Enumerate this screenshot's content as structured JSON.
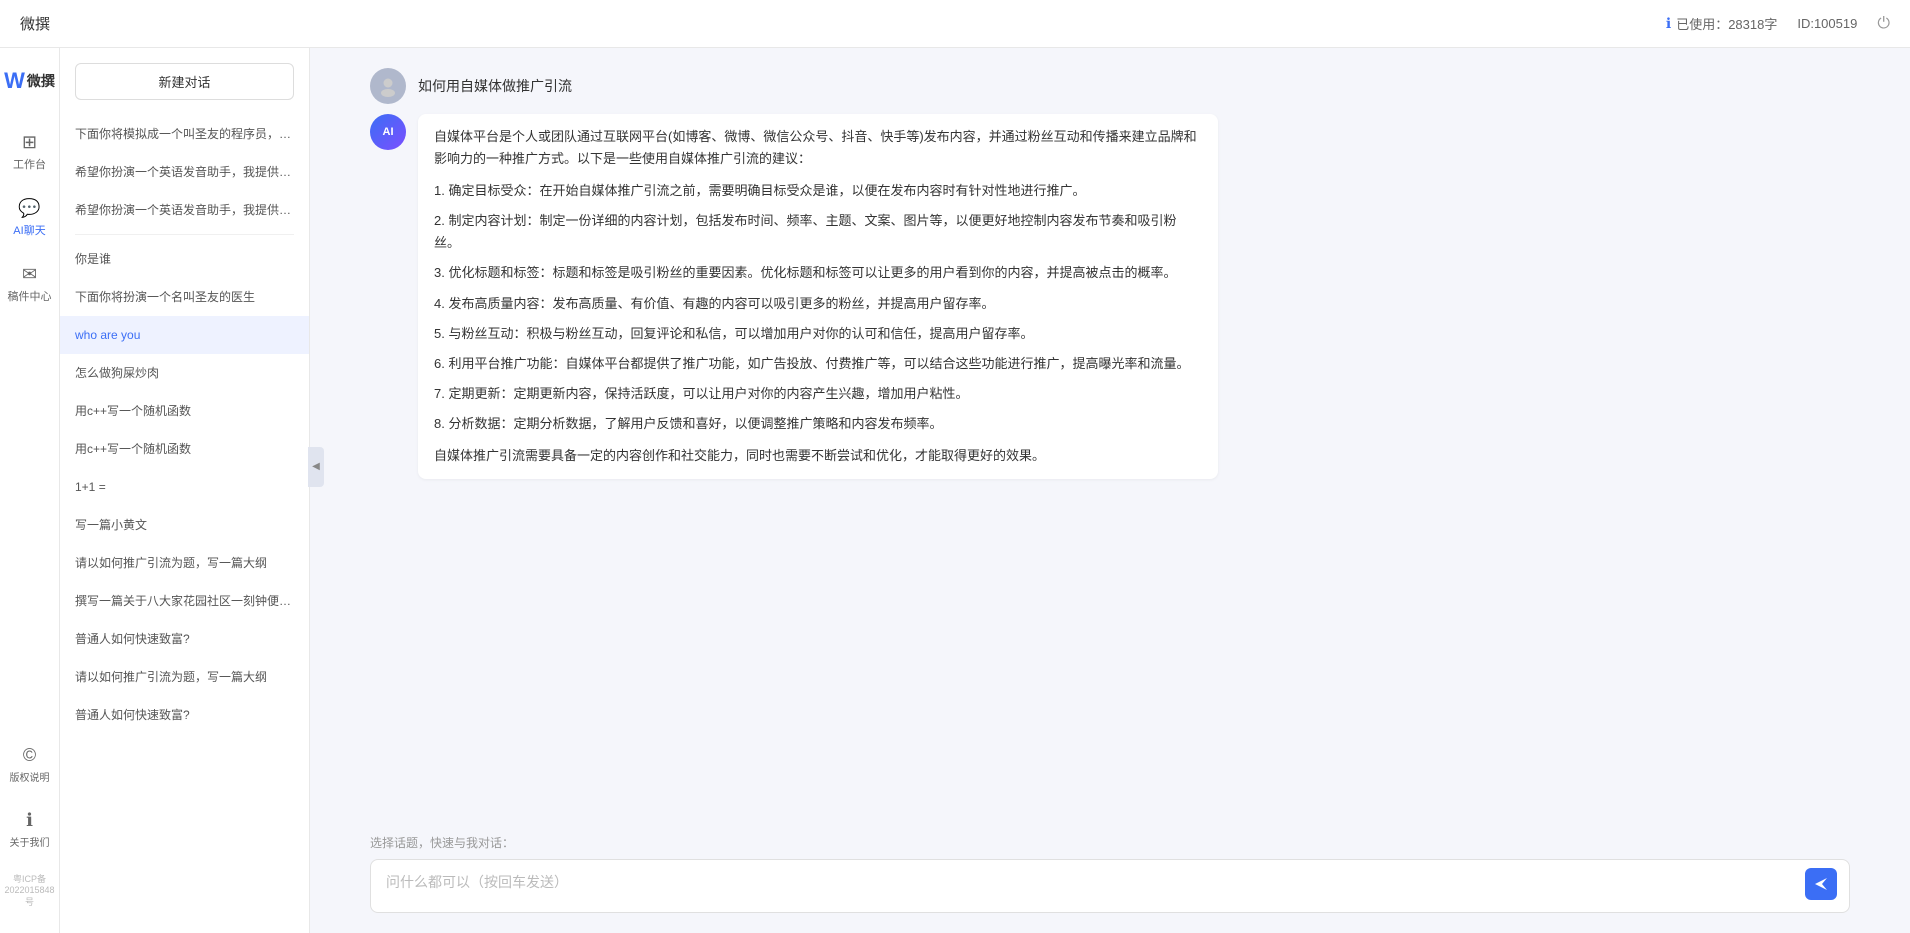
{
  "topbar": {
    "title": "微撰",
    "usage_label": "已使用：28318字",
    "id_label": "ID:100519",
    "usage_icon": "ℹ",
    "logout_icon": "⏻"
  },
  "sidebar_narrow": {
    "logo": "W",
    "logo_text": "微撰",
    "nav_items": [
      {
        "id": "workbench",
        "icon": "⊞",
        "label": "工作台",
        "active": false
      },
      {
        "id": "ai-chat",
        "icon": "💬",
        "label": "AI聊天",
        "active": true
      },
      {
        "id": "drafts",
        "icon": "✉",
        "label": "稿件中心",
        "active": false
      }
    ],
    "footer_items": [
      {
        "id": "copyright",
        "icon": "©",
        "label": "版权说明"
      },
      {
        "id": "about",
        "icon": "ℹ",
        "label": "关于我们"
      }
    ],
    "icp": "粤ICP备2022015848号"
  },
  "history": {
    "new_chat_label": "新建对话",
    "items": [
      {
        "id": 1,
        "text": "下面你将模拟成一个叫圣友的程序员，我说...",
        "active": false
      },
      {
        "id": 2,
        "text": "希望你扮演一个英语发音助手，我提供给你...",
        "active": false
      },
      {
        "id": 3,
        "text": "希望你扮演一个英语发音助手，我提供给你...",
        "active": false
      },
      {
        "id": 4,
        "text": "你是谁",
        "active": false
      },
      {
        "id": 5,
        "text": "下面你将扮演一个名叫圣友的医生",
        "active": false
      },
      {
        "id": 6,
        "text": "who are you",
        "active": true
      },
      {
        "id": 7,
        "text": "怎么做狗屎炒肉",
        "active": false
      },
      {
        "id": 8,
        "text": "用c++写一个随机函数",
        "active": false
      },
      {
        "id": 9,
        "text": "用c++写一个随机函数",
        "active": false
      },
      {
        "id": 10,
        "text": "1+1 =",
        "active": false
      },
      {
        "id": 11,
        "text": "写一篇小黄文",
        "active": false
      },
      {
        "id": 12,
        "text": "请以如何推广引流为题，写一篇大纲",
        "active": false
      },
      {
        "id": 13,
        "text": "撰写一篇关于八大家花园社区一刻钟便民生...",
        "active": false
      },
      {
        "id": 14,
        "text": "普通人如何快速致富?",
        "active": false
      },
      {
        "id": 15,
        "text": "请以如何推广引流为题，写一篇大纲",
        "active": false
      },
      {
        "id": 16,
        "text": "普通人如何快速致富?",
        "active": false
      }
    ]
  },
  "chat": {
    "user_question": "如何用自媒体做推广引流",
    "ai_response_paragraphs": [
      "自媒体平台是个人或团队通过互联网平台(如博客、微博、微信公众号、抖音、快手等)发布内容，并通过粉丝互动和传播来建立品牌和影响力的一种推广方式。以下是一些使用自媒体推广引流的建议：",
      "1. 确定目标受众：在开始自媒体推广引流之前，需要明确目标受众是谁，以便在发布内容时有针对性地进行推广。",
      "2. 制定内容计划：制定一份详细的内容计划，包括发布时间、频率、主题、文案、图片等，以便更好地控制内容发布节奏和吸引粉丝。",
      "3. 优化标题和标签：标题和标签是吸引粉丝的重要因素。优化标题和标签可以让更多的用户看到你的内容，并提高被点击的概率。",
      "4. 发布高质量内容：发布高质量、有价值、有趣的内容可以吸引更多的粉丝，并提高用户留存率。",
      "5. 与粉丝互动：积极与粉丝互动，回复评论和私信，可以增加用户对你的认可和信任，提高用户留存率。",
      "6. 利用平台推广功能：自媒体平台都提供了推广功能，如广告投放、付费推广等，可以结合这些功能进行推广，提高曝光率和流量。",
      "7. 定期更新：定期更新内容，保持活跃度，可以让用户对你的内容产生兴趣，增加用户粘性。",
      "8. 分析数据：定期分析数据，了解用户反馈和喜好，以便调整推广策略和内容发布频率。",
      "自媒体推广引流需要具备一定的内容创作和社交能力，同时也需要不断尝试和优化，才能取得更好的效果。"
    ],
    "quick_topic_label": "选择话题，快速与我对话：",
    "input_placeholder": "问什么都可以（按回车发送）",
    "send_icon": "➤"
  }
}
